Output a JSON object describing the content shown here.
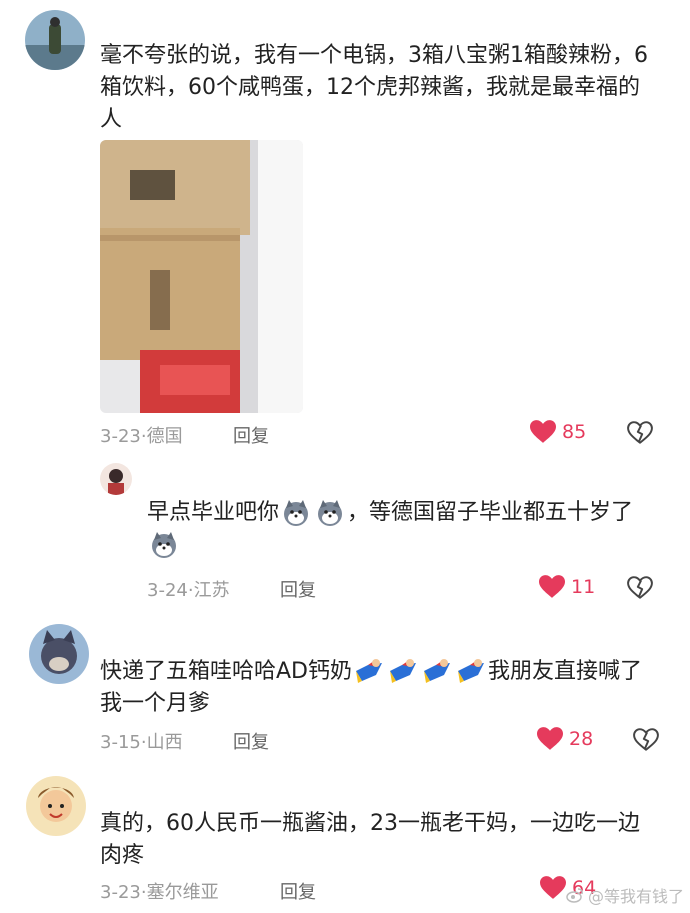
{
  "comments": [
    {
      "text": "毫不夸张的说，我有一个电锅，3箱八宝粥1箱酸辣粉，6箱饮料，60个咸鸭蛋，12个虎邦辣酱，我就是最幸福的人",
      "date": "3-23",
      "location": "德国",
      "reply_label": "回复",
      "likes": "85"
    },
    {
      "text_a": "早点毕业吧你",
      "text_b": "，等德国留子毕业都五十岁了",
      "date": "3-24",
      "location": "江苏",
      "reply_label": "回复",
      "likes": "11"
    },
    {
      "text_a": "快递了五箱哇哈哈AD钙奶",
      "text_b": "我朋友直接喊了我一个月爹",
      "date": "3-15",
      "location": "山西",
      "reply_label": "回复",
      "likes": "28"
    },
    {
      "text": "真的，60人民币一瓶酱油，23一瓶老干妈，一边吃一边肉疼",
      "date": "3-23",
      "location": "塞尔维亚",
      "reply_label": "回复",
      "likes": "64"
    }
  ],
  "watermark": "@等我有钱了",
  "colors": {
    "like": "#e53a5c",
    "meta": "#9a9a9a"
  }
}
